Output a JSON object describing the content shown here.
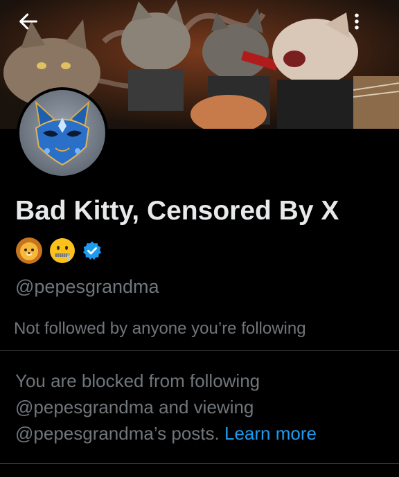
{
  "header": {
    "back_icon": "arrow-left-icon",
    "more_icon": "more-vertical-icon"
  },
  "profile": {
    "display_name": "Bad Kitty, Censored By X",
    "badges": [
      "lion-face-emoji",
      "zipper-mouth-face-emoji",
      "verified-badge-icon"
    ],
    "handle": "@pepesgrandma",
    "followed_by": "Not followed by anyone you’re following"
  },
  "blocked_notice": {
    "text": "You are blocked from following @pepesgrandma and viewing @pepesgrandma’s posts.",
    "link": "Learn more"
  },
  "colors": {
    "background": "#000000",
    "primary_text": "#e7e9ea",
    "secondary_text": "#71767b",
    "link": "#1d9bf0",
    "divider": "#2f3336"
  }
}
